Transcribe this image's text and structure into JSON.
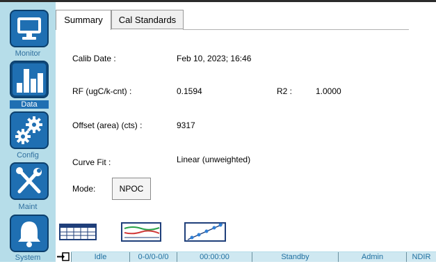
{
  "nav": [
    {
      "label": "Monitor",
      "icon": "monitor-icon",
      "active": false
    },
    {
      "label": "Data",
      "icon": "bar-chart-icon",
      "active": true
    },
    {
      "label": "Config",
      "icon": "gears-icon",
      "active": false
    },
    {
      "label": "Maint",
      "icon": "tools-icon",
      "active": false
    },
    {
      "label": "System",
      "icon": "bell-icon",
      "active": false
    }
  ],
  "tabs": [
    {
      "label": "Summary",
      "active": true
    },
    {
      "label": "Cal Standards",
      "active": false
    }
  ],
  "summary": {
    "calib_date_label": "Calib Date :",
    "calib_date_value": "Feb 10, 2023; 16:46",
    "rf_label": "RF (ugC/k-cnt) :",
    "rf_value": "0.1594",
    "r2_label": "R2 :",
    "r2_value": "1.0000",
    "offset_label": "Offset (area) (cts) :",
    "offset_value": "9317",
    "curve_fit_label": "Curve Fit :",
    "curve_fit_value": "Linear (unweighted)",
    "mode_label": "Mode:",
    "mode_value": "NPOC"
  },
  "toolbar": [
    {
      "icon": "table-view-icon"
    },
    {
      "icon": "trend-chart-icon"
    },
    {
      "icon": "calibration-curve-icon"
    }
  ],
  "status": {
    "state": "Idle",
    "position": "0-0/0-0/0",
    "time": "00:00:00",
    "mode": "Standby",
    "user": "Admin",
    "detector": "NDIR"
  },
  "colors": {
    "sidebar_bg": "#b6dde9",
    "nav_button": "#1f6fb2",
    "status_bg": "#cfe8f1"
  }
}
